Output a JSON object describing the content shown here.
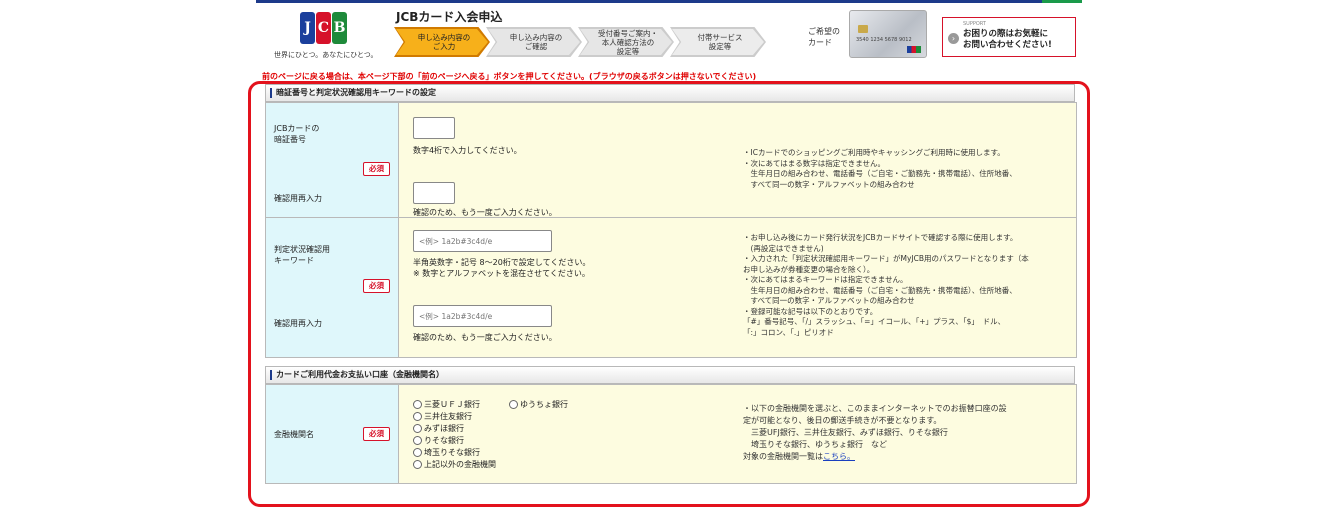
{
  "header": {
    "app_title": "JCBカード入会申込",
    "tagline": "世界にひとつ。あなたにひとつ。",
    "logo_letters": [
      "J",
      "C",
      "B"
    ],
    "steps": [
      {
        "label": "申し込み内容の\nご入力",
        "active": true
      },
      {
        "label": "申し込み内容の\nご確認",
        "active": false
      },
      {
        "label": "受付番号ご案内・\n本人確認方法の\n設定等",
        "active": false
      },
      {
        "label": "付帯サービス\n設定等",
        "active": false
      }
    ],
    "card_label": "ご希望の\nカード",
    "card_number": "3540 1234 5678 9012",
    "support_small": "SUPPORT",
    "support_text": "お困りの際はお気軽に\nお問い合わせください!",
    "support_icon": "chevron-right-icon"
  },
  "warning": "前のページに戻る場合は、本ページ下部の「前のページへ戻る」ボタンを押してください。(ブラウザの戻るボタンは押さないでください)",
  "section1": {
    "title": "暗証番号と判定状況確認用キーワードの設定",
    "pin": {
      "label": "JCBカードの\n暗証番号",
      "required": "必須",
      "confirm_label": "確認用再入力",
      "value": "",
      "confirm_value": "",
      "help": "数字4桁で入力してください。",
      "confirm_help": "確認のため、もう一度ご入力ください。",
      "notes": [
        "・ICカードでのショッピングご利用時やキャッシングご利用時に使用します。",
        "・次にあてはまる数字は指定できません。",
        "　生年月日の組み合わせ、電話番号（ご自宅・ご勤務先・携帯電話）、住所地番、",
        "　すべて同一の数字・アルファベットの組み合わせ"
      ]
    },
    "keyword": {
      "label": "判定状況確認用\nキーワード",
      "required": "必須",
      "confirm_label": "確認用再入力",
      "placeholder": "<例> 1a2b#3c4d/e",
      "confirm_placeholder": "<例> 1a2b#3c4d/e",
      "help": "半角英数字・記号 8～20桁で設定してください。\n※ 数字とアルファベットを混在させてください。",
      "confirm_help": "確認のため、もう一度ご入力ください。",
      "notes": [
        "・お申し込み後にカード発行状況をJCBカードサイトで確認する際に使用します。",
        "　(再設定はできません)",
        "・入力された「判定状況確認用キーワード」がMyJCB用のパスワードとなります（本",
        "お申し込みが券種変更の場合を除く）。",
        "・次にあてはまるキーワードは指定できません。",
        "　生年月日の組み合わせ、電話番号（ご自宅・ご勤務先・携帯電話）、住所地番、",
        "　すべて同一の数字・アルファベットの組み合わせ",
        "・登録可能な記号は以下のとおりです。",
        "「#」番号記号、「/」スラッシュ、「=」イコール、「+」プラス、「$」　ドル、",
        "「:」コロン、「.」ピリオド"
      ]
    }
  },
  "section2": {
    "title": "カードご利用代金お支払い口座（金融機関名）",
    "bank": {
      "label": "金融機関名",
      "required": "必須",
      "options": [
        "三菱ＵＦＪ銀行",
        "ゆうちょ銀行",
        "三井住友銀行",
        "みずほ銀行",
        "りそな銀行",
        "埼玉りそな銀行",
        "上記以外の金融機関"
      ],
      "notes": [
        "・以下の金融機関を選ぶと、このままインターネットでのお振替口座の設",
        "定が可能となり、後日の郵送手続きが不要となります。",
        "　三菱UFJ銀行、三井住友銀行、みずほ銀行、りそな銀行",
        "　埼玉りそな銀行、ゆうちょ銀行　など"
      ],
      "list_text": "対象の金融機関一覧は",
      "list_link": "こちら。"
    }
  },
  "colors": {
    "label_bg": "#dff7fb",
    "field_bg": "#fdfce0",
    "required": "#d6122a",
    "warning": "#e00000",
    "highlight": "#e3121c",
    "active_step": "#f7b01a"
  }
}
